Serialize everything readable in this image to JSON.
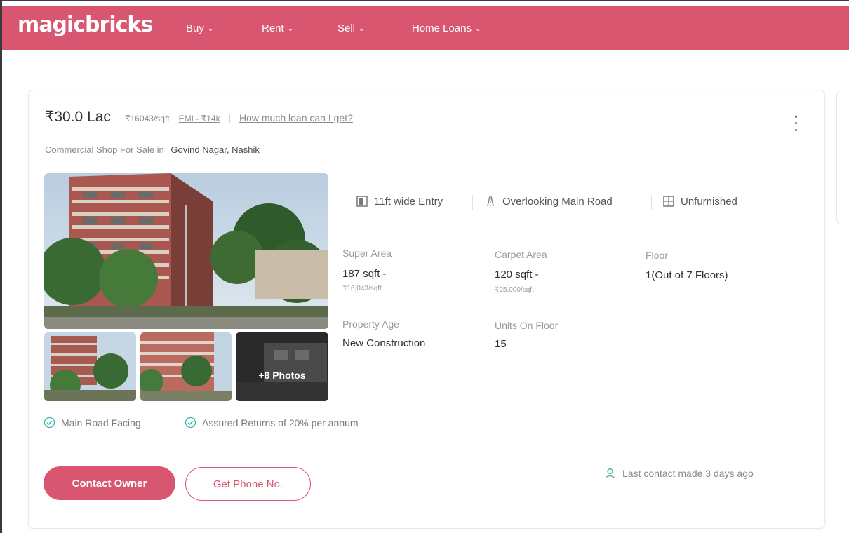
{
  "brand": {
    "name": "magicbricks",
    "color": "#d8566f"
  },
  "nav": [
    {
      "label": "Buy",
      "icon": "chevron-down-icon"
    },
    {
      "label": "Rent",
      "icon": "chevron-down-icon"
    },
    {
      "label": "Sell",
      "icon": "chevron-down-icon"
    },
    {
      "label": "Home Loans",
      "icon": "chevron-down-icon"
    }
  ],
  "listing": {
    "price": "₹30.0 Lac",
    "price_per_sqft": "₹16043/sqft",
    "emi": "EMI - ₹14k",
    "separator": "|",
    "loan_link": "How much loan can I get?",
    "subtitle_prefix": "Commercial Shop For Sale in",
    "locality": "Govind Nagar, Nashik",
    "more_photos": "+8 Photos",
    "highlights": [
      {
        "label": "11ft wide Entry",
        "icon": "entry-icon"
      },
      {
        "label": "Overlooking Main Road",
        "icon": "road-icon"
      },
      {
        "label": "Unfurnished",
        "icon": "furnishing-icon"
      }
    ],
    "summary": {
      "super_area": {
        "label": "Super Area",
        "value": "187 sqft -",
        "sub": "₹16,043/sqft"
      },
      "carpet_area": {
        "label": "Carpet Area",
        "value": "120 sqft -",
        "sub": "₹25,000/sqft"
      },
      "floor": {
        "label": "Floor",
        "value": "1(Out of 7 Floors)"
      },
      "property_age": {
        "label": "Property Age",
        "value": "New Construction"
      },
      "units_on_floor": {
        "label": "Units On Floor",
        "value": "15"
      }
    },
    "amenities": [
      {
        "label": "Main Road Facing",
        "icon": "check-circle-icon"
      },
      {
        "label": "Assured Returns of 20% per annum",
        "icon": "check-circle-icon"
      }
    ],
    "actions": {
      "contact_owner": "Contact Owner",
      "get_phone": "Get Phone No."
    },
    "last_contact": "Last contact made 3 days ago"
  }
}
